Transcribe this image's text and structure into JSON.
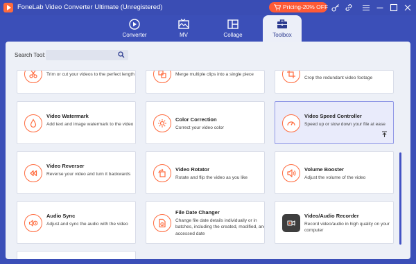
{
  "app": {
    "title": "FoneLab Video Converter Ultimate (Unregistered)"
  },
  "titlebar": {
    "pricing_label": "Pricing-20% OFF",
    "icons": [
      "key-icon",
      "link-icon",
      "menu-icon",
      "minimize-icon",
      "maximize-icon",
      "close-icon"
    ]
  },
  "nav": {
    "tabs": [
      {
        "label": "Converter",
        "icon": "converter-icon"
      },
      {
        "label": "MV",
        "icon": "mv-icon"
      },
      {
        "label": "Collage",
        "icon": "collage-icon"
      },
      {
        "label": "Toolbox",
        "icon": "toolbox-icon",
        "active": true
      }
    ]
  },
  "search": {
    "label": "Search Tool:",
    "value": "",
    "placeholder": ""
  },
  "tools": {
    "trim": {
      "title": "",
      "desc": "Trim or cut your videos to the perfect length",
      "icon": "trim-icon"
    },
    "merge": {
      "title": "",
      "desc": "Merge multiple clips into a single piece",
      "icon": "merge-icon"
    },
    "crop": {
      "title": "",
      "desc": "Crop the redundant video footage",
      "icon": "crop-icon"
    },
    "watermark": {
      "title": "Video Watermark",
      "desc": "Add text and image watermark to the video",
      "icon": "watermark-icon"
    },
    "color": {
      "title": "Color Correction",
      "desc": "Correct your video color",
      "icon": "color-correction-icon"
    },
    "speed": {
      "title": "Video Speed Controller",
      "desc": "Speed up or slow down your file at ease",
      "icon": "speed-icon"
    },
    "reverser": {
      "title": "Video Reverser",
      "desc": "Reverse your video and turn it backwards",
      "icon": "reverse-icon"
    },
    "rotator": {
      "title": "Video Rotator",
      "desc": "Rotate and flip the video as you like",
      "icon": "rotate-icon"
    },
    "volume": {
      "title": "Volume Booster",
      "desc": "Adjust the volume of the video",
      "icon": "volume-icon"
    },
    "audiosync": {
      "title": "Audio Sync",
      "desc": "Adjust and sync the audio with the video",
      "icon": "audio-sync-icon"
    },
    "filedate": {
      "title": "File Date Changer",
      "desc": "Change file date details individually or in batches, including the created, modified, and accessed date",
      "icon": "file-date-icon"
    },
    "recorder": {
      "title": "Video/Audio Recorder",
      "desc": "Record video/audio in high quality on your computer",
      "icon": "recorder-icon"
    }
  },
  "colors": {
    "brand_bg": "#3b4fb8",
    "accent": "#ff6a3d",
    "selected_border": "#8f97e6"
  }
}
